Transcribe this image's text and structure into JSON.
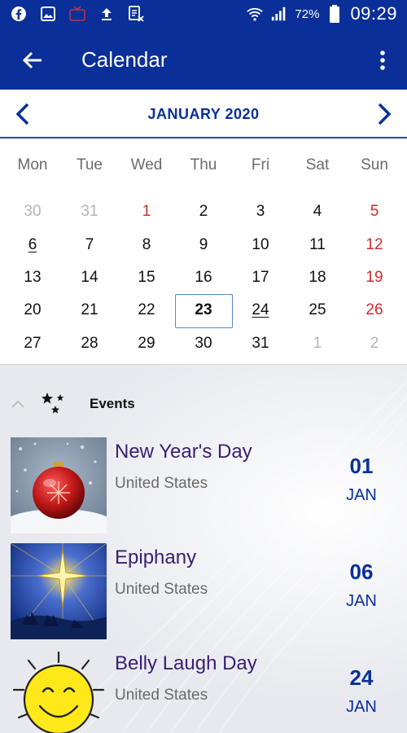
{
  "status_bar": {
    "left_icons": [
      "facebook-icon",
      "image-icon",
      "tv-icon",
      "upload-icon",
      "document-x-icon"
    ],
    "battery": "72%",
    "time": "09:29"
  },
  "app_bar": {
    "title": "Calendar"
  },
  "month_nav": {
    "title": "JANUARY 2020"
  },
  "calendar": {
    "weekdays": [
      "Mon",
      "Tue",
      "Wed",
      "Thu",
      "Fri",
      "Sat",
      "Sun"
    ],
    "weeks": [
      [
        {
          "d": "30",
          "s": "muted"
        },
        {
          "d": "31",
          "s": "muted"
        },
        {
          "d": "1",
          "s": "red"
        },
        {
          "d": "2",
          "s": ""
        },
        {
          "d": "3",
          "s": ""
        },
        {
          "d": "4",
          "s": ""
        },
        {
          "d": "5",
          "s": "red"
        }
      ],
      [
        {
          "d": "6",
          "s": "underline"
        },
        {
          "d": "7",
          "s": ""
        },
        {
          "d": "8",
          "s": ""
        },
        {
          "d": "9",
          "s": ""
        },
        {
          "d": "10",
          "s": ""
        },
        {
          "d": "11",
          "s": ""
        },
        {
          "d": "12",
          "s": "red"
        }
      ],
      [
        {
          "d": "13",
          "s": ""
        },
        {
          "d": "14",
          "s": ""
        },
        {
          "d": "15",
          "s": ""
        },
        {
          "d": "16",
          "s": ""
        },
        {
          "d": "17",
          "s": ""
        },
        {
          "d": "18",
          "s": ""
        },
        {
          "d": "19",
          "s": "red"
        }
      ],
      [
        {
          "d": "20",
          "s": ""
        },
        {
          "d": "21",
          "s": ""
        },
        {
          "d": "22",
          "s": ""
        },
        {
          "d": "23",
          "s": "today"
        },
        {
          "d": "24",
          "s": "underline"
        },
        {
          "d": "25",
          "s": ""
        },
        {
          "d": "26",
          "s": "red"
        }
      ],
      [
        {
          "d": "27",
          "s": ""
        },
        {
          "d": "28",
          "s": ""
        },
        {
          "d": "29",
          "s": ""
        },
        {
          "d": "30",
          "s": ""
        },
        {
          "d": "31",
          "s": ""
        },
        {
          "d": "1",
          "s": "muted"
        },
        {
          "d": "2",
          "s": "muted"
        }
      ]
    ]
  },
  "events": {
    "header": "Events",
    "items": [
      {
        "name": "New Year's Day",
        "country": "United States",
        "day": "01",
        "month": "JAN",
        "thumb": "ornament"
      },
      {
        "name": "Epiphany",
        "country": "United States",
        "day": "06",
        "month": "JAN",
        "thumb": "star"
      },
      {
        "name": "Belly Laugh Day",
        "country": "United States",
        "day": "24",
        "month": "JAN",
        "thumb": "sun"
      }
    ]
  },
  "colors": {
    "brand_blue": "#0a2f98",
    "weekend_red": "#d22a2a",
    "event_title": "#3a1e72"
  }
}
